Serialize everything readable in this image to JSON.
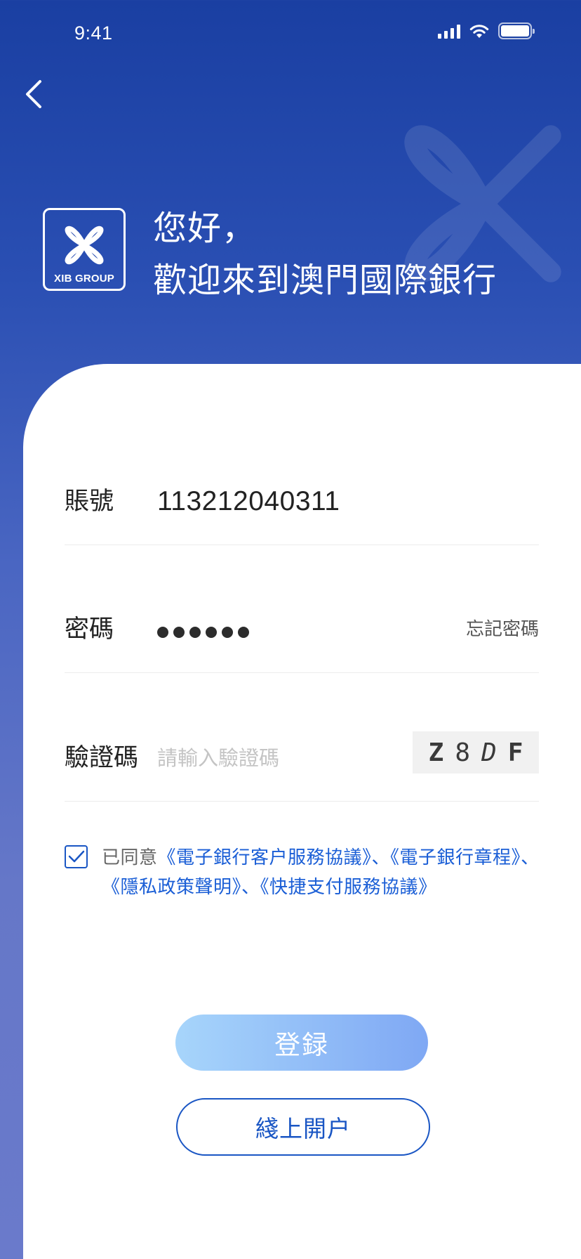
{
  "status_bar": {
    "time": "9:41",
    "icons": [
      "signal-icon",
      "wifi-icon",
      "battery-icon"
    ]
  },
  "nav": {
    "back_icon": "chevron-left-icon"
  },
  "hero": {
    "logo_text": "XIB GROUP",
    "greeting_line1": "您好，",
    "greeting_line2": "歡迎來到澳門國際銀行"
  },
  "form": {
    "account": {
      "label": "賬號",
      "value": "113212040311"
    },
    "password": {
      "label": "密碼",
      "masked_length": 6,
      "forgot_label": "忘記密碼"
    },
    "captcha": {
      "label": "驗證碼",
      "placeholder": "請輸入驗證碼",
      "chars": [
        "Z",
        "8",
        "D",
        "F"
      ]
    }
  },
  "agreement": {
    "checked": true,
    "prefix": "已同意",
    "links": [
      "《電子銀行客户服務協議》",
      "、",
      "《電子銀行章程》",
      "、",
      "《隱私政策聲明》",
      "、",
      "《快捷支付服務協議》"
    ]
  },
  "buttons": {
    "login": "登録",
    "open_account": "綫上開户"
  },
  "colors": {
    "accent": "#1a56c4",
    "link": "#1a5ed6",
    "bg_top": "#1a3fa2",
    "bg_bottom": "#6a7acb"
  }
}
